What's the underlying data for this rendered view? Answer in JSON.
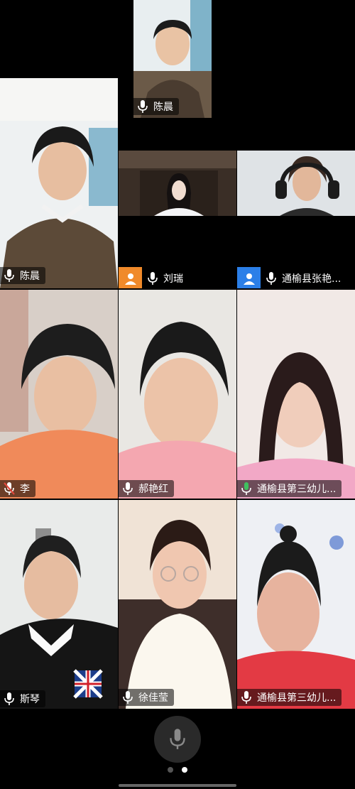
{
  "participants": {
    "top": {
      "name": "陈晨",
      "mic": "on"
    },
    "left_large": {
      "name": "陈晨",
      "mic": "on"
    },
    "liu": {
      "name": "刘瑞",
      "mic": "on",
      "avatar_color": "#f08a2a"
    },
    "tongyu1": {
      "name": "通榆县张艳...",
      "mic": "on",
      "avatar_color": "#2b7fe8"
    },
    "li": {
      "name": "李",
      "mic": "muted"
    },
    "hao": {
      "name": "郝艳红",
      "mic": "on"
    },
    "tongyu2": {
      "name": "通榆县第三幼儿...",
      "mic": "speaking"
    },
    "si": {
      "name": "斯琴",
      "mic": "on"
    },
    "xu": {
      "name": "徐佳莹",
      "mic": "on"
    },
    "tongyu3": {
      "name": "通榆县第三幼儿...",
      "mic": "on"
    }
  },
  "colors": {
    "active_speaker": "#3fbf5f",
    "muted": "#e0483b"
  },
  "pager": {
    "pages": 2,
    "current": 2
  }
}
